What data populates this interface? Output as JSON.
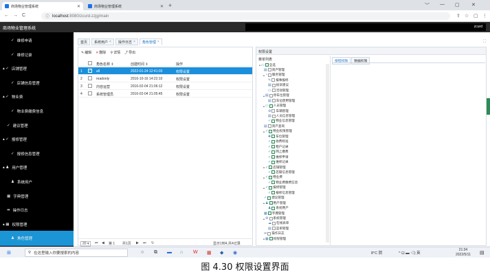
{
  "browser": {
    "tabs": [
      {
        "label": "商场物业管理系统",
        "active": true
      },
      {
        "label": "商场物业管理系统",
        "active": false
      }
    ],
    "new_tab": "+",
    "controls": [
      "﹀",
      "—",
      "▢",
      "✕"
    ],
    "url_host": "localhost",
    "url_path": ":8080/zcurd-zzjg/main",
    "nav": [
      "←",
      "→",
      "C",
      "ⓘ"
    ]
  },
  "app": {
    "title": "商场物业管理系统",
    "user": "zcurd"
  },
  "sidebar": {
    "items": [
      {
        "label": "维修申请",
        "prefix": "✓",
        "active": false,
        "indent": 2
      },
      {
        "label": "维修记录",
        "prefix": "✓",
        "active": false,
        "indent": 2
      },
      {
        "label": "店铺管理",
        "prefix": "▴ ✓",
        "active": false,
        "indent": 0
      },
      {
        "label": "店铺信息管理",
        "prefix": "✓",
        "active": false,
        "indent": 2
      },
      {
        "label": "物业费",
        "prefix": "▴ ✓",
        "active": false,
        "indent": 0
      },
      {
        "label": "物业费缴费信息",
        "prefix": "✓",
        "active": false,
        "indent": 2
      },
      {
        "label": "建议管理",
        "prefix": "✓",
        "active": false,
        "indent": 1
      },
      {
        "label": "报修管理",
        "prefix": "▴ ✓",
        "active": false,
        "indent": 0
      },
      {
        "label": "报修信息管理",
        "prefix": "✓",
        "active": false,
        "indent": 2
      },
      {
        "label": "用户管理",
        "prefix": "▴ ♟",
        "active": false,
        "indent": 0
      },
      {
        "label": "系统用户",
        "prefix": "♟",
        "active": false,
        "indent": 2
      },
      {
        "label": "字典管理",
        "prefix": "▦",
        "active": false,
        "indent": 1
      },
      {
        "label": "操作日志",
        "prefix": "⇹",
        "active": false,
        "indent": 1
      },
      {
        "label": "权限管理",
        "prefix": "▴ ▦",
        "active": false,
        "indent": 0
      },
      {
        "label": "角色管理",
        "prefix": "♟",
        "active": true,
        "indent": 2
      }
    ]
  },
  "page_tabs": [
    {
      "label": "首页",
      "closable": false,
      "active": false
    },
    {
      "label": "系统用户",
      "closable": true,
      "active": false
    },
    {
      "label": "操作日志",
      "closable": true,
      "active": false
    },
    {
      "label": "角色管理",
      "closable": true,
      "active": true
    }
  ],
  "toolbar": {
    "edit": "编辑",
    "delete": "删除",
    "detail": "详情",
    "export": "导出"
  },
  "table": {
    "headers": {
      "name": "角色名称 ⇕",
      "created": "创建时间 ⇕",
      "action": "操作"
    },
    "rows": [
      {
        "num": "1",
        "name": "all",
        "created": "2022-01-24 12:41:03",
        "action": "权限设置",
        "selected": true
      },
      {
        "num": "2",
        "name": "readonly",
        "created": "2016-10-16 14:22:10",
        "action": "权限设置",
        "selected": false
      },
      {
        "num": "3",
        "name": "内容运营",
        "created": "2016-02-04 21:06:12",
        "action": "权限设置",
        "selected": false
      },
      {
        "num": "4",
        "name": "系统管理员",
        "created": "2016-02-04 21:05:45",
        "action": "权限设置",
        "selected": false
      }
    ]
  },
  "pager": {
    "size": "20 ▾",
    "first": "⏮",
    "prev": "◀",
    "page_label": "第 1",
    "total_pages": "共1页",
    "next": "▶",
    "last": "⏭",
    "refresh": "↻",
    "summary": "显示1到4,共4记录"
  },
  "permission": {
    "header": "权限设置",
    "tree_title": "菜单列表",
    "tabs": [
      "按钮权限",
      "数据权限"
    ],
    "tree": [
      {
        "label": "全选",
        "level": 0,
        "checked": true,
        "arrow": "▴",
        "icon": "▭"
      },
      {
        "label": "资产管理",
        "level": 1,
        "checked": false,
        "arrow": "",
        "icon": "▤"
      },
      {
        "label": "服务管理",
        "level": 1,
        "checked": false,
        "arrow": "▴",
        "icon": "◔"
      },
      {
        "label": "报事报修",
        "level": 2,
        "checked": false,
        "arrow": "",
        "icon": "✎"
      },
      {
        "label": "投诉建议",
        "level": 2,
        "checked": false,
        "arrow": "",
        "icon": "▤"
      },
      {
        "label": "活动管理",
        "level": 2,
        "checked": false,
        "arrow": "",
        "icon": "▭"
      },
      {
        "label": "停车位管理",
        "level": 1,
        "checked": false,
        "arrow": "▴",
        "icon": "▤"
      },
      {
        "label": "车位使用管理",
        "level": 2,
        "checked": false,
        "arrow": "",
        "icon": "▤"
      },
      {
        "label": "人员管理",
        "level": 1,
        "checked": true,
        "arrow": "▴",
        "icon": "▭"
      },
      {
        "label": "车辆管理",
        "level": 2,
        "checked": false,
        "arrow": "",
        "icon": "⚙"
      },
      {
        "label": "人员信息管理",
        "level": 2,
        "checked": false,
        "arrow": "",
        "icon": "▤"
      },
      {
        "label": "物业信息管理",
        "level": 2,
        "checked": true,
        "arrow": "",
        "icon": "✓"
      },
      {
        "label": "资产查询",
        "level": 1,
        "checked": false,
        "arrow": "",
        "icon": "▤"
      },
      {
        "label": "物业权限管理",
        "level": 1,
        "checked": true,
        "arrow": "▴",
        "icon": "✓"
      },
      {
        "label": "车位管理",
        "level": 2,
        "checked": true,
        "arrow": "",
        "icon": "✚"
      },
      {
        "label": "收费标准",
        "level": 2,
        "checked": true,
        "arrow": "",
        "icon": "✓"
      },
      {
        "label": "租户记录",
        "level": 2,
        "checked": true,
        "arrow": "",
        "icon": "✓"
      },
      {
        "label": "网上缴费",
        "level": 2,
        "checked": true,
        "arrow": "",
        "icon": "✓"
      },
      {
        "label": "维修申请",
        "level": 2,
        "checked": true,
        "arrow": "",
        "icon": "✓"
      },
      {
        "label": "维修记录",
        "level": 2,
        "checked": true,
        "arrow": "",
        "icon": "✓"
      },
      {
        "label": "店铺管理",
        "level": 1,
        "checked": true,
        "arrow": "▴",
        "icon": "✓"
      },
      {
        "label": "店铺信息管理",
        "level": 2,
        "checked": true,
        "arrow": "",
        "icon": "✓"
      },
      {
        "label": "物业费",
        "level": 1,
        "checked": true,
        "arrow": "▴",
        "icon": "✓"
      },
      {
        "label": "物业费缴费信息",
        "level": 2,
        "checked": true,
        "arrow": "",
        "icon": "✓"
      },
      {
        "label": "报修管理",
        "level": 1,
        "checked": true,
        "arrow": "▴",
        "icon": "✓"
      },
      {
        "label": "报修信息管理",
        "level": 2,
        "checked": true,
        "arrow": "",
        "icon": "✓"
      },
      {
        "label": "建议管理",
        "level": 1,
        "checked": true,
        "arrow": "",
        "icon": "✓"
      },
      {
        "label": "用户管理",
        "level": 1,
        "checked": true,
        "arrow": "▴",
        "icon": "♟"
      },
      {
        "label": "系统用户",
        "level": 2,
        "checked": true,
        "arrow": "",
        "icon": "♟"
      },
      {
        "label": "字典管理",
        "level": 1,
        "checked": true,
        "arrow": "",
        "icon": "▦"
      },
      {
        "label": "系统管理",
        "level": 1,
        "checked": false,
        "arrow": "▴",
        "icon": "⚙"
      },
      {
        "label": "在线表单",
        "level": 2,
        "checked": false,
        "arrow": "",
        "icon": "☁"
      },
      {
        "label": "菜单管理",
        "level": 2,
        "checked": false,
        "arrow": "",
        "icon": "▤"
      },
      {
        "label": "操作日志",
        "level": 1,
        "checked": false,
        "arrow": "",
        "icon": "⇹"
      },
      {
        "label": "权限管理",
        "level": 1,
        "checked": true,
        "arrow": "▴",
        "icon": "▦"
      }
    ]
  },
  "taskbar": {
    "search_placeholder": "在这里输入你要搜索的内容",
    "weather": "8°C 阴",
    "tray": "^ ⊡ ▬ ◁) 英",
    "time": "21:34",
    "date": "2022/5/11"
  },
  "caption": "图 4.30  权限设置界面"
}
